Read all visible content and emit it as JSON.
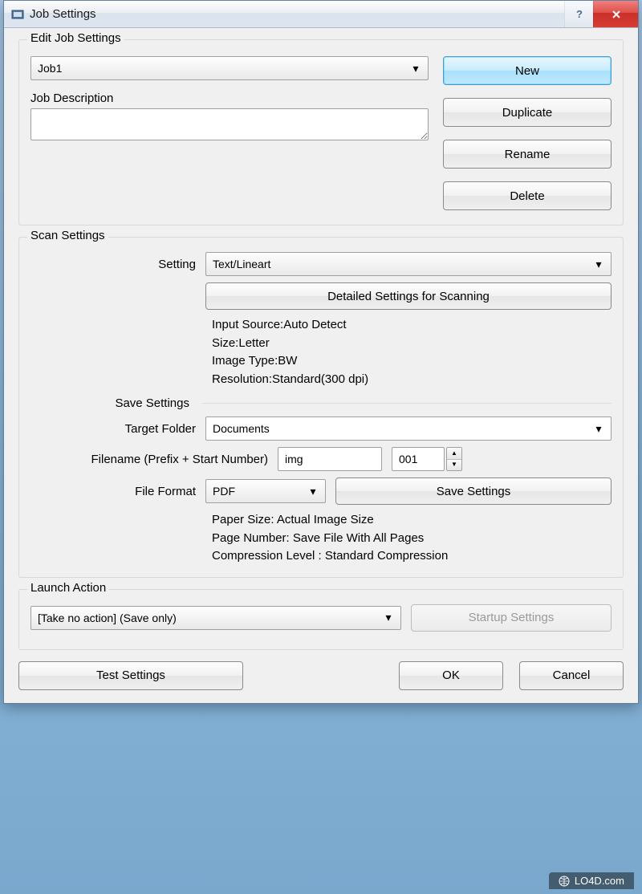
{
  "window": {
    "title": "Job Settings"
  },
  "editJob": {
    "legend": "Edit Job Settings",
    "job_value": "Job1",
    "desc_label": "Job Description",
    "desc_value": "",
    "buttons": {
      "new": "New",
      "duplicate": "Duplicate",
      "rename": "Rename",
      "delete": "Delete"
    }
  },
  "scan": {
    "legend": "Scan Settings",
    "setting_label": "Setting",
    "setting_value": "Text/Lineart",
    "detailed_btn": "Detailed Settings for Scanning",
    "info": {
      "input_source": "Input Source:Auto Detect",
      "size": "Size:Letter",
      "image_type": "Image Type:BW",
      "resolution": "Resolution:Standard(300 dpi)"
    },
    "save_legend": "Save Settings",
    "target_folder_label": "Target Folder",
    "target_folder_value": "Documents",
    "filename_label": "Filename (Prefix + Start Number)",
    "prefix_value": "img",
    "number_value": "001",
    "file_format_label": "File Format",
    "file_format_value": "PDF",
    "save_settings_btn": "Save Settings",
    "save_info": {
      "paper": "Paper Size: Actual Image Size",
      "page": "Page Number: Save File With All Pages",
      "compression": "Compression Level : Standard Compression"
    }
  },
  "launch": {
    "legend": "Launch Action",
    "value": "[Take no action] (Save only)",
    "startup_btn": "Startup Settings"
  },
  "footer": {
    "test": "Test Settings",
    "ok": "OK",
    "cancel": "Cancel"
  },
  "watermark": "LO4D.com"
}
